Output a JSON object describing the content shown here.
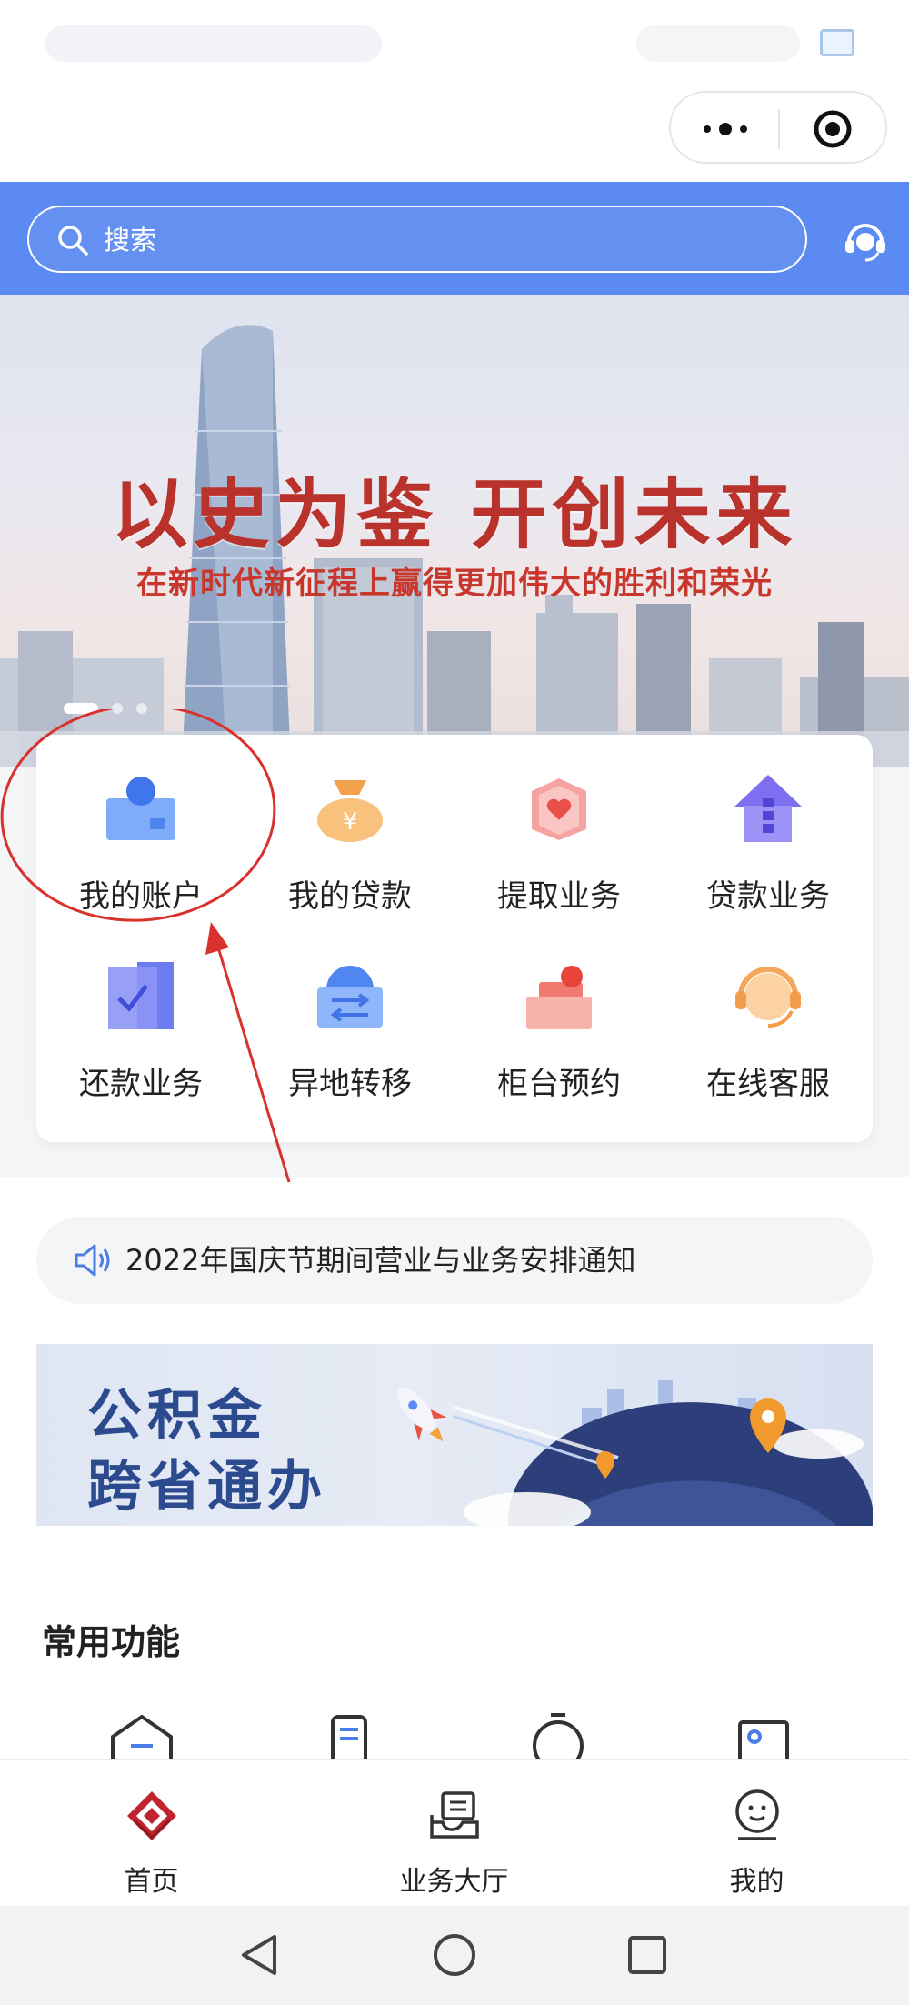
{
  "header": {
    "search_placeholder": "搜索",
    "accent_color": "#5b8af2"
  },
  "banner": {
    "title": "以史为鉴  开创未来",
    "subtitle": "在新时代新征程上赢得更加伟大的胜利和荣光"
  },
  "features": [
    {
      "label": "我的账户",
      "icon": "account-icon"
    },
    {
      "label": "我的贷款",
      "icon": "money-bag-icon"
    },
    {
      "label": "提取业务",
      "icon": "withdraw-icon"
    },
    {
      "label": "贷款业务",
      "icon": "house-icon"
    },
    {
      "label": "还款业务",
      "icon": "repayment-icon"
    },
    {
      "label": "异地转移",
      "icon": "transfer-icon"
    },
    {
      "label": "柜台预约",
      "icon": "counter-icon"
    },
    {
      "label": "在线客服",
      "icon": "headset-icon"
    }
  ],
  "notice": {
    "text": "2022年国庆节期间营业与业务安排通知",
    "icon": "speaker-icon"
  },
  "promo": {
    "line1": "公积金",
    "line2": "跨省通办"
  },
  "common": {
    "title": "常用功能"
  },
  "tabbar": {
    "items": [
      {
        "label": "首页",
        "icon": "home-logo-icon"
      },
      {
        "label": "业务大厅",
        "icon": "hall-icon"
      },
      {
        "label": "我的",
        "icon": "profile-icon"
      }
    ]
  },
  "colors": {
    "banner_text": "#b9332c",
    "annotation": "#d9312b"
  }
}
